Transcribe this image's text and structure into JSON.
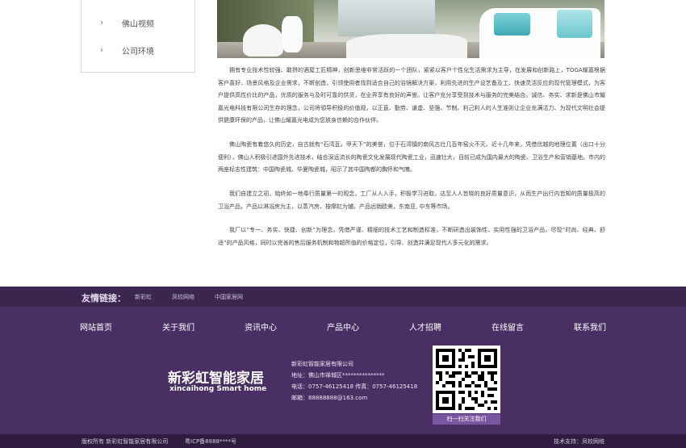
{
  "sidebar": {
    "items": [
      {
        "label": "佛山视频",
        "icon": "chevron-right-icon"
      },
      {
        "label": "公司环境",
        "icon": "chevron-right-icon"
      }
    ]
  },
  "article": {
    "paragraphs": [
      "拥有专业技术性较强、敢拼的酒屋工匠精神，创新思维非常活跃的一个团队，紧紧以客户个性化生活需求为主导，在发展和创新路上，TOGA耀嘉根据客户喜好、场景风格及企业需求，不断创造，引领使用者找到适合自己的浴镜解决方案，利用先进的生产设艺备及工、快速灵活反应的现代管理模式，为客户提供高性价比的产品，优质的服务与及时可靠的供货，在业界享有良好的声誉。让客户充分享受到技术与服务的完美结合。诚信、务实、求新是佛山市耀嘉光电科技有限公司生存的理念，公司将領导积极的价值观，以正直、勤劳、谦虚、坚强、节制、利己利人的人生准则让企业充满活力、为现代文明社会提供健康环保的产品，让佛山耀嘉光电成为您放身信赖的合作伙伴。",
      "佛山陶瓷有着悠久的历史，自古就有“石湾瓦，甲天下”的美誉，位于石湾镇的南风古灶几百年窑火不灭。近十几年来，凭借优越的地理位置（出口十分便利），佛山人积极引进国外先进技术，结合深远流长的陶瓷文化发展现代陶瓷工业，迅速壮大，目前已成为国内最大的陶瓷、卫浴生产和营销基地。市内的两座标志性建筑：中国陶瓷城、华夏陶瓷城，昭示了其中国陶都的胸怀和气魄。",
      "我们自建立之初，始终如一地奉行质量第一的观念，工厂从人入手，积极学习进取，达至人人皆晓的良好质量意识，从而生产出行内皆知的质量极高的卫浴产品，产品以淋浴房为主，以蒸汽房、按摩缸为辅，产品远销欧美，东南亚, 中东等市场。",
      "我厂以“专一、务实、快捷、创新”为理念，凭借严谨、精细的技术工艺和制造标准，不断研造出装饰性、实用性强的卫浴产品，尽现“时尚、经典、舒适”的产品风格，同时以完善的售后服务机制和物超所值的价格定位，引导、创造并满足现代人多元化的需求。"
    ]
  },
  "friend_links": {
    "title": "友情链接：",
    "links": [
      "新彩虹",
      "凤较网络",
      "中国家居网"
    ]
  },
  "footer_nav": [
    "网站首页",
    "关于我们",
    "资讯中心",
    "产品中心",
    "人才招聘",
    "在线留言",
    "联系我们"
  ],
  "brand": {
    "name": "新彩虹智能家居",
    "slogan": "xincaihong Smart home"
  },
  "contact": {
    "company": "新彩虹智能家居有限公司",
    "address": "地址：佛山市禅城区***************",
    "phone_fax": "电话：0757-46125418    传真：0757-46125418",
    "email": "邮箱：88888888@163.com"
  },
  "qr": {
    "caption": "扫一扫关注我们",
    "icon": "qr-code-icon"
  },
  "bottom": {
    "copyright": "版权所有    新彩虹智能家居有限公司",
    "icp": "粤ICP备8888****号",
    "support": "技术支持：凤较网络"
  },
  "colors": {
    "footer_bg": "#4a2f64",
    "links_bar_bg": "#3b2650",
    "bottom_bar_bg": "#2f1c40",
    "qr_caption_bg": "#7a55a0"
  }
}
